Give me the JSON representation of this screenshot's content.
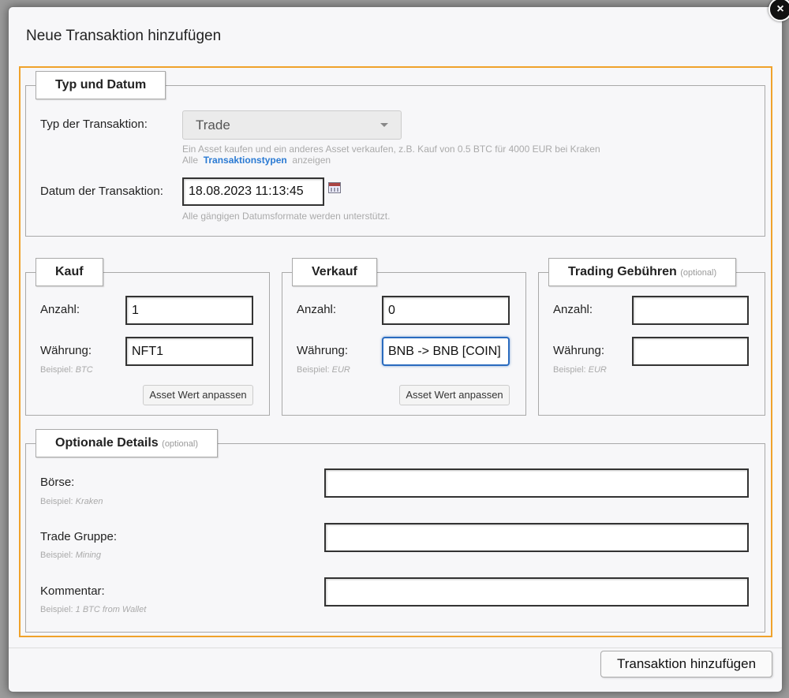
{
  "dialog": {
    "title": "Neue Transaktion hinzufügen",
    "close_label": "×",
    "submit_label": "Transaktion hinzufügen"
  },
  "typ_datum": {
    "legend": "Typ und Datum",
    "type_label": "Typ der Transaktion:",
    "type_value": "Trade",
    "type_hint": "Ein Asset kaufen und ein anderes Asset verkaufen, z.B. Kauf von 0.5 BTC für 4000 EUR bei Kraken",
    "types_prefix": "Alle",
    "types_link": "Transaktionstypen",
    "types_suffix": "anzeigen",
    "date_label": "Datum der Transaktion:",
    "date_value": "18.08.2023 11:13:45",
    "date_hint": "Alle gängigen Datumsformate werden unterstützt."
  },
  "kauf": {
    "legend": "Kauf",
    "amount_label": "Anzahl:",
    "amount_value": "1",
    "currency_label": "Währung:",
    "currency_value": "NFT1",
    "example_prefix": "Beispiel:",
    "example_value": "BTC",
    "adjust_label": "Asset Wert anpassen"
  },
  "verkauf": {
    "legend": "Verkauf",
    "amount_label": "Anzahl:",
    "amount_value": "0",
    "currency_label": "Währung:",
    "currency_value": "BNB -> BNB [COIN]",
    "example_prefix": "Beispiel:",
    "example_value": "EUR",
    "adjust_label": "Asset Wert anpassen"
  },
  "gebuehren": {
    "legend": "Trading Gebühren",
    "legend_optional": "(optional)",
    "amount_label": "Anzahl:",
    "amount_value": "",
    "currency_label": "Währung:",
    "currency_value": "",
    "example_prefix": "Beispiel:",
    "example_value": "EUR"
  },
  "optional": {
    "legend": "Optionale Details",
    "legend_optional": "(optional)",
    "exchange_label": "Börse:",
    "exchange_example_prefix": "Beispiel:",
    "exchange_example": "Kraken",
    "group_label": "Trade Gruppe:",
    "group_example_prefix": "Beispiel:",
    "group_example": "Mining",
    "comment_label": "Kommentar:",
    "comment_example_prefix": "Beispiel:",
    "comment_example": "1 BTC from Wallet"
  },
  "colors": {
    "accent_border": "#f0a22b",
    "link": "#2a7ad3",
    "focus": "#2a6bbf"
  }
}
